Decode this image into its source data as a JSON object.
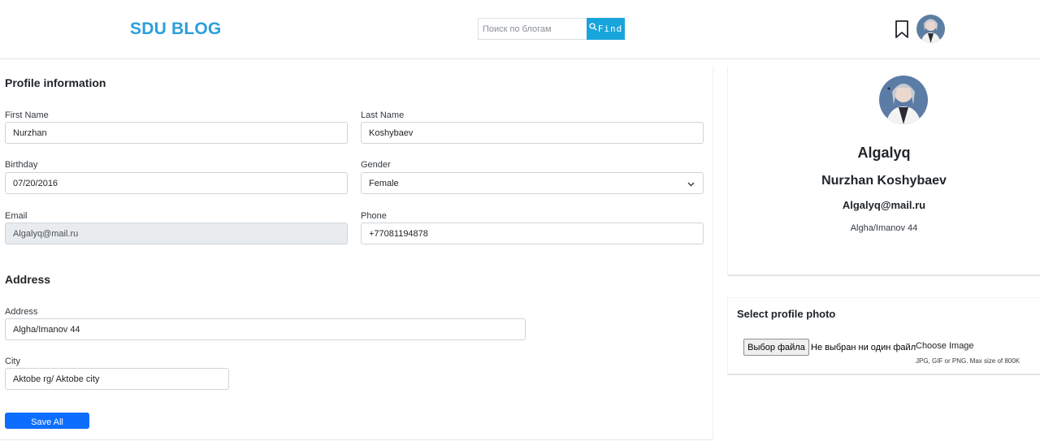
{
  "header": {
    "logo": "SDU BLOG",
    "search_placeholder": "Поиск по блогам",
    "find_label": "Find"
  },
  "profile_info": {
    "title": "Profile information",
    "first_name": {
      "label": "First Name",
      "value": "Nurzhan"
    },
    "last_name": {
      "label": "Last Name",
      "value": "Koshybaev"
    },
    "birthday": {
      "label": "Birthday",
      "value": "07/20/2016"
    },
    "gender": {
      "label": "Gender",
      "value": "Female"
    },
    "email": {
      "label": "Email",
      "value": "Algalyq@mail.ru"
    },
    "phone": {
      "label": "Phone",
      "value": "+77081194878"
    }
  },
  "address_section": {
    "title": "Address",
    "address": {
      "label": "Address",
      "value": "Algha/Imanov 44"
    },
    "city": {
      "label": "City",
      "value": "Aktobe rg/ Aktobe city"
    }
  },
  "save_label": "Save All",
  "profile_card": {
    "username": "Algalyq",
    "full_name": "Nurzhan Koshybaev",
    "email": "Algalyq@mail.ru",
    "address": "Algha/Imanov 44"
  },
  "photo_card": {
    "title": "Select profile photo",
    "file_button": "Выбор файла",
    "file_status": "Не выбран ни один файл",
    "choose_label": "Choose Image",
    "hint": "JPG, GIF or PNG. Max size of 800K"
  },
  "colors": {
    "brand": "#2b9fd8",
    "find_button": "#18a5dc",
    "primary_button": "#0d6efd"
  }
}
